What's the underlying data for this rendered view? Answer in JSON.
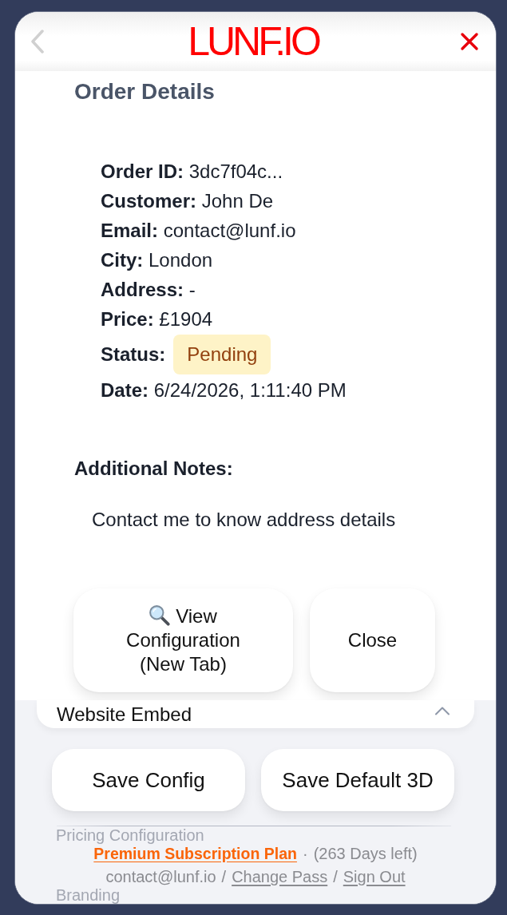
{
  "header": {
    "logo": "LUNF.IO"
  },
  "modal": {
    "title": "Order Details",
    "details": [
      {
        "kind": "text",
        "label": "Order ID:",
        "value": "3dc7f04c..."
      },
      {
        "kind": "text",
        "label": "Customer:",
        "value": "John De"
      },
      {
        "kind": "text",
        "label": "Email:",
        "value": "contact@lunf.io"
      },
      {
        "kind": "text",
        "label": "City:",
        "value": "London"
      },
      {
        "kind": "text",
        "label": "Address:",
        "value": "-"
      },
      {
        "kind": "text",
        "label": "Price:",
        "value": "£1904"
      },
      {
        "kind": "badge",
        "label": "Status:",
        "value": "Pending"
      },
      {
        "kind": "text",
        "label": "Date:",
        "value": "6/24/2026, 1:11:40 PM"
      }
    ],
    "notes_label": "Additional Notes:",
    "notes": "Contact me to know address details",
    "buttons": [
      {
        "kind": "view",
        "label": "View Configuration (New Tab)"
      },
      {
        "kind": "close",
        "label": "Close"
      }
    ]
  },
  "embed_section": {
    "title": "Website Embed",
    "expanded": true
  },
  "save_buttons": [
    "Save Config",
    "Save Default 3D"
  ],
  "footer": {
    "rows": [
      {
        "kind": "covered",
        "text": "Pricing Configuration"
      },
      {
        "kind": "line",
        "parts": [
          {
            "kind": "plan",
            "text": "Premium Subscription Plan"
          },
          {
            "kind": "separator",
            "text": "·"
          },
          {
            "kind": "text",
            "text": "(263 Days left)"
          }
        ]
      },
      {
        "kind": "line",
        "parts": [
          {
            "kind": "text",
            "text": "contact@lunf.io"
          },
          {
            "kind": "separator",
            "text": "/"
          },
          {
            "kind": "link",
            "text": "Change Pass"
          },
          {
            "kind": "separator",
            "text": "/"
          },
          {
            "kind": "link",
            "text": "Sign Out"
          }
        ]
      },
      {
        "kind": "covered",
        "text": "Branding"
      }
    ]
  }
}
